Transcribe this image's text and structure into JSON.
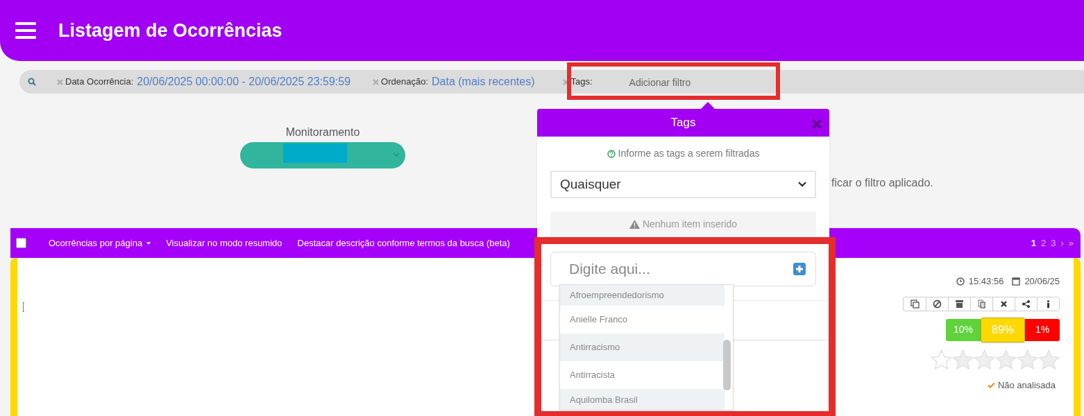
{
  "header": {
    "title": "Listagem de Ocorrências"
  },
  "filter_bar": {
    "filters": [
      {
        "label": "Data Ocorrência:",
        "value": "20/06/2025 00:00:00 - 20/06/2025 23:59:59"
      },
      {
        "label": "Ordenação:",
        "value": "Data (mais recentes)"
      },
      {
        "label": "Tags:",
        "placeholder": "Adicionar filtro"
      }
    ]
  },
  "monitoring": {
    "label": "Monitoramento"
  },
  "hidden_text": "ficar o filtro aplicado.",
  "tags_popup": {
    "title": "Tags",
    "hint": "Informe as tags a serem filtradas",
    "match_select": "Quaisquer",
    "empty_notice": "Nenhum item inserido",
    "input_placeholder": "Digite aqui...",
    "suggestions": [
      "Afroempreendedorismo",
      "Anielle Franco",
      "Antirracismo",
      "Antirracista",
      "Aquilomba Brasil"
    ]
  },
  "toolbar": {
    "items": [
      "Ocorrências por página",
      "Visualizar no modo resumido",
      "Destacar descrição conforme termos da busca (beta)"
    ],
    "select_all_checked": false,
    "pages": [
      {
        "label": "1",
        "selected": true
      },
      {
        "label": "2",
        "selected": false
      },
      {
        "label": "3",
        "selected": false
      },
      {
        "label": "›",
        "selected": false
      },
      {
        "label": "»",
        "selected": false
      }
    ]
  },
  "occurrence": {
    "time": "15:43:56",
    "date": "20/06/25",
    "sentiment": [
      {
        "label": "10%",
        "color": "#5fd33a",
        "selected": false
      },
      {
        "label": "89%",
        "color": "#ffd800",
        "selected": true
      },
      {
        "label": "1%",
        "color": "#ff0000",
        "selected": false
      }
    ],
    "stars": 0,
    "status": "Não analisada"
  }
}
